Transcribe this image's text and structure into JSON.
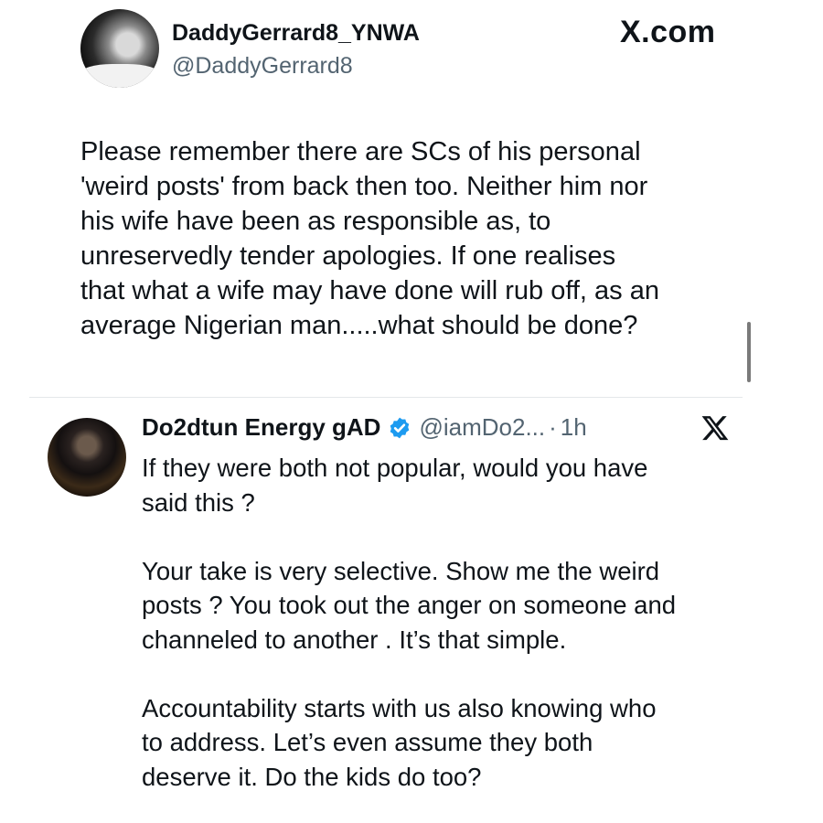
{
  "brand": "X.com",
  "tweet": {
    "author_name": "DaddyGerrard8_YNWA",
    "author_handle": "@DaddyGerrard8",
    "text": "Please remember there are SCs of his personal\n'weird posts' from back then too. Neither him nor\nhis wife have been as responsible as, to\nunreservedly tender apologies. If one realises\nthat what a wife may have done will rub off, as an\naverage Nigerian man.....what should be done?"
  },
  "reply": {
    "author_name": "Do2dtun Energy gAD",
    "author_handle": "@iamDo2...",
    "separator": "·",
    "time": "1h",
    "verified": true,
    "text": "If they were both not popular, would you have\nsaid this ?\n\nYour take is very selective. Show me the weird\nposts ? You took out the anger on someone and\nchanneled to another . It’s that simple.\n\nAccountability starts with us also knowing who\nto address. Let’s even assume they both\ndeserve it. Do the kids do too?"
  },
  "icons": {
    "verified": "verified-badge-icon",
    "x_logo": "x-logo-icon"
  },
  "colors": {
    "verified_blue": "#1d9bf0",
    "secondary_text": "#536471"
  }
}
